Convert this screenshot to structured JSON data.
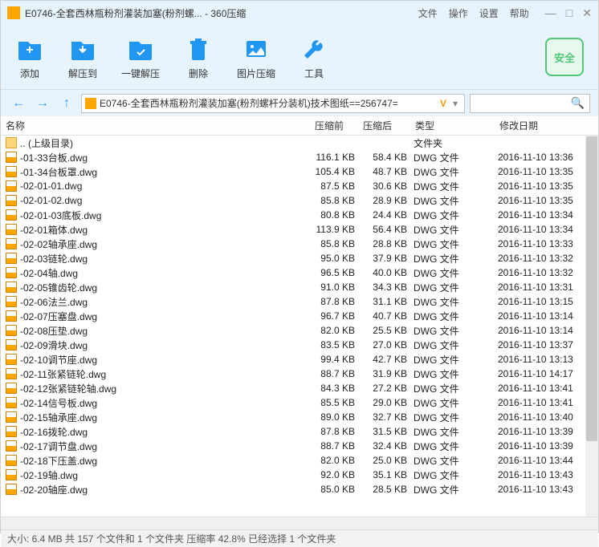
{
  "title": "E0746-全套西林瓶粉剂灌装加塞(粉剂螺... - 360压缩",
  "menus": {
    "file": "文件",
    "operate": "操作",
    "settings": "设置",
    "help": "帮助"
  },
  "toolbar": {
    "add": "添加",
    "extract": "解压到",
    "one_click": "一键解压",
    "delete": "删除",
    "image": "图片压缩",
    "tools": "工具",
    "safe": "安全"
  },
  "path": {
    "text": "E0746-全套西林瓶粉剂灌装加塞(粉剂螺杆分装机)技术图纸==256747=",
    "v": "V"
  },
  "columns": {
    "name": "名称",
    "before": "压缩前",
    "after": "压缩后",
    "type": "类型",
    "date": "修改日期"
  },
  "parent": {
    "label": ".. (上级目录)",
    "type": "文件夹"
  },
  "files": [
    {
      "name": "-01-33台板.dwg",
      "before": "116.1 KB",
      "after": "58.4 KB",
      "type": "DWG 文件",
      "date": "2016-11-10 13:36"
    },
    {
      "name": "-01-34台板罩.dwg",
      "before": "105.4 KB",
      "after": "48.7 KB",
      "type": "DWG 文件",
      "date": "2016-11-10 13:35"
    },
    {
      "name": "-02-01-01.dwg",
      "before": "87.5 KB",
      "after": "30.6 KB",
      "type": "DWG 文件",
      "date": "2016-11-10 13:35"
    },
    {
      "name": "-02-01-02.dwg",
      "before": "85.8 KB",
      "after": "28.9 KB",
      "type": "DWG 文件",
      "date": "2016-11-10 13:35"
    },
    {
      "name": "-02-01-03底板.dwg",
      "before": "80.8 KB",
      "after": "24.4 KB",
      "type": "DWG 文件",
      "date": "2016-11-10 13:34"
    },
    {
      "name": "-02-01箱体.dwg",
      "before": "113.9 KB",
      "after": "56.4 KB",
      "type": "DWG 文件",
      "date": "2016-11-10 13:34"
    },
    {
      "name": "-02-02轴承座.dwg",
      "before": "85.8 KB",
      "after": "28.8 KB",
      "type": "DWG 文件",
      "date": "2016-11-10 13:33"
    },
    {
      "name": "-02-03链轮.dwg",
      "before": "95.0 KB",
      "after": "37.9 KB",
      "type": "DWG 文件",
      "date": "2016-11-10 13:32"
    },
    {
      "name": "-02-04轴.dwg",
      "before": "96.5 KB",
      "after": "40.0 KB",
      "type": "DWG 文件",
      "date": "2016-11-10 13:32"
    },
    {
      "name": "-02-05锥齿轮.dwg",
      "before": "91.0 KB",
      "after": "34.3 KB",
      "type": "DWG 文件",
      "date": "2016-11-10 13:31"
    },
    {
      "name": "-02-06法兰.dwg",
      "before": "87.8 KB",
      "after": "31.1 KB",
      "type": "DWG 文件",
      "date": "2016-11-10 13:15"
    },
    {
      "name": "-02-07压塞盘.dwg",
      "before": "96.7 KB",
      "after": "40.7 KB",
      "type": "DWG 文件",
      "date": "2016-11-10 13:14"
    },
    {
      "name": "-02-08压垫.dwg",
      "before": "82.0 KB",
      "after": "25.5 KB",
      "type": "DWG 文件",
      "date": "2016-11-10 13:14"
    },
    {
      "name": "-02-09滑块.dwg",
      "before": "83.5 KB",
      "after": "27.0 KB",
      "type": "DWG 文件",
      "date": "2016-11-10 13:37"
    },
    {
      "name": "-02-10调节座.dwg",
      "before": "99.4 KB",
      "after": "42.7 KB",
      "type": "DWG 文件",
      "date": "2016-11-10 13:13"
    },
    {
      "name": "-02-11张紧链轮.dwg",
      "before": "88.7 KB",
      "after": "31.9 KB",
      "type": "DWG 文件",
      "date": "2016-11-10 14:17"
    },
    {
      "name": "-02-12张紧链轮轴.dwg",
      "before": "84.3 KB",
      "after": "27.2 KB",
      "type": "DWG 文件",
      "date": "2016-11-10 13:41"
    },
    {
      "name": "-02-14信号板.dwg",
      "before": "85.5 KB",
      "after": "29.0 KB",
      "type": "DWG 文件",
      "date": "2016-11-10 13:41"
    },
    {
      "name": "-02-15轴承座.dwg",
      "before": "89.0 KB",
      "after": "32.7 KB",
      "type": "DWG 文件",
      "date": "2016-11-10 13:40"
    },
    {
      "name": "-02-16拨轮.dwg",
      "before": "87.8 KB",
      "after": "31.5 KB",
      "type": "DWG 文件",
      "date": "2016-11-10 13:39"
    },
    {
      "name": "-02-17调节盘.dwg",
      "before": "88.7 KB",
      "after": "32.4 KB",
      "type": "DWG 文件",
      "date": "2016-11-10 13:39"
    },
    {
      "name": "-02-18下压盖.dwg",
      "before": "82.0 KB",
      "after": "25.0 KB",
      "type": "DWG 文件",
      "date": "2016-11-10 13:44"
    },
    {
      "name": "-02-19轴.dwg",
      "before": "92.0 KB",
      "after": "35.1 KB",
      "type": "DWG 文件",
      "date": "2016-11-10 13:43"
    },
    {
      "name": "-02-20轴座.dwg",
      "before": "85.0 KB",
      "after": "28.5 KB",
      "type": "DWG 文件",
      "date": "2016-11-10 13:43"
    }
  ],
  "status": "大小: 6.4 MB 共 157 个文件和 1 个文件夹 压缩率 42.8% 已经选择 1 个文件夹"
}
